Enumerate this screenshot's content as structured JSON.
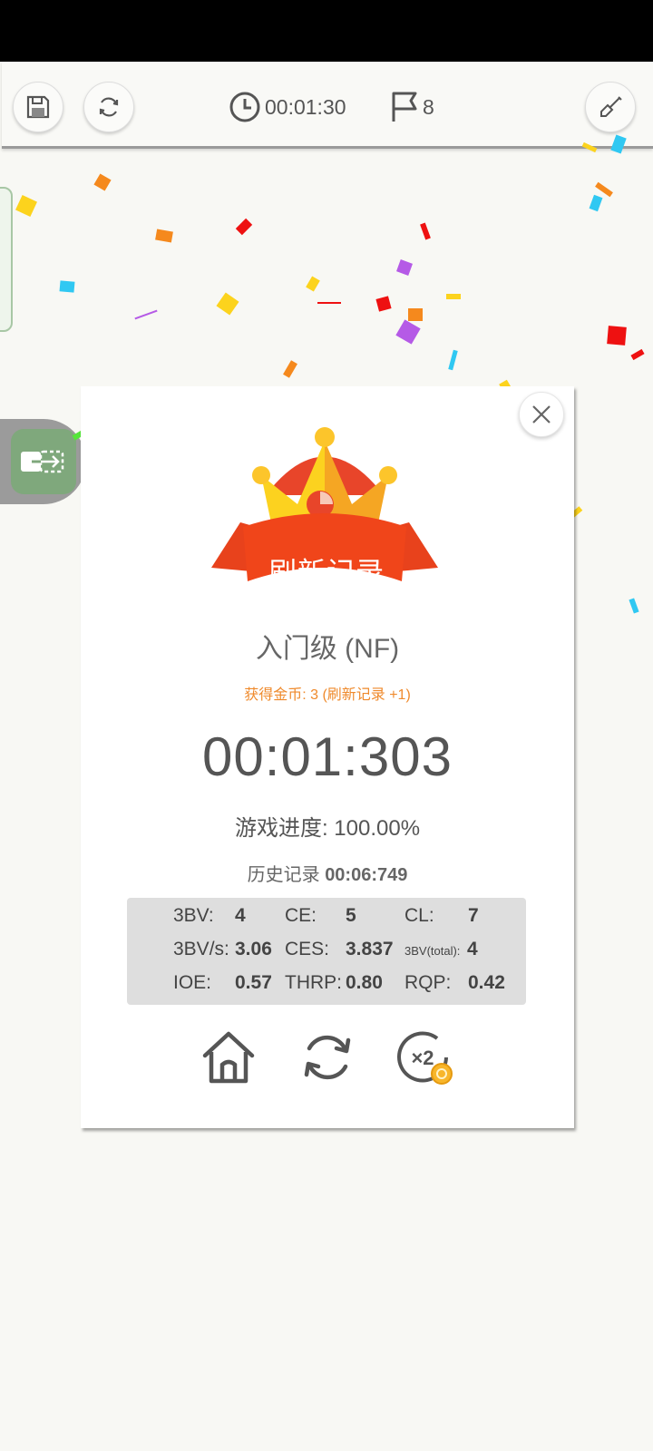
{
  "toolbar": {
    "timer": "00:01:30",
    "flag_count": "8"
  },
  "dialog": {
    "banner": "刷新记录",
    "level": "入门级 (NF)",
    "coins": "获得金币: 3 (刷新记录 +1)",
    "time": "00:01:303",
    "progress_label": "游戏进度:",
    "progress_value": "100.00%",
    "history_label": "历史记录",
    "history_value": "00:06:749",
    "stats": {
      "bv_label": "3BV:",
      "bv": "4",
      "ce_label": "CE:",
      "ce": "5",
      "cl_label": "CL:",
      "cl": "7",
      "bvs_label": "3BV/s:",
      "bvs": "3.06",
      "ces_label": "CES:",
      "ces": "3.837",
      "bvtotal_label": "3BV(total):",
      "bvtotal": "4",
      "ioe_label": "IOE:",
      "ioe": "0.57",
      "thrp_label": "THRP:",
      "thrp": "0.80",
      "rqp_label": "RQP:",
      "rqp": "0.42"
    },
    "double_coin_label": "×2"
  },
  "icons": [
    "save-icon",
    "restart-icon",
    "clock-icon",
    "flag-icon",
    "shovel-icon",
    "close-icon",
    "switch-icon",
    "home-icon",
    "replay-icon",
    "double-reward-icon",
    "crown-icon"
  ],
  "colors": {
    "accent_orange": "#ef8a2c",
    "banner_red": "#e8421c",
    "crown_yellow": "#fcc52b",
    "stats_bg": "#dedede"
  }
}
